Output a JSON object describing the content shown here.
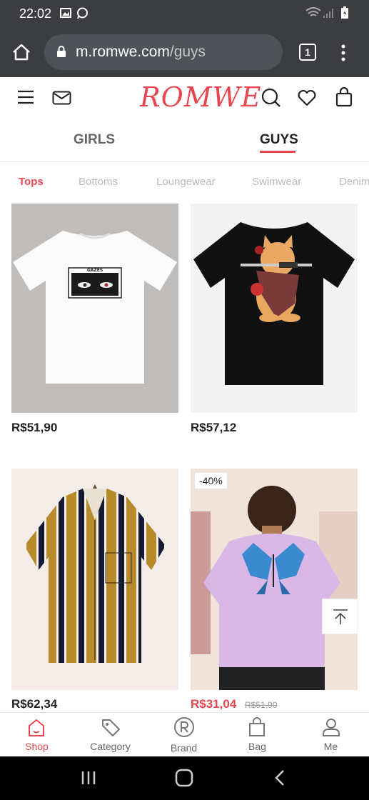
{
  "status_bar": {
    "time": "22:02"
  },
  "browser": {
    "domain": "m.romwe.com",
    "path": "/guys",
    "tab_count": "1"
  },
  "site": {
    "logo": "ROMWE",
    "gender_tabs": [
      {
        "label": "GIRLS"
      },
      {
        "label": "GUYS"
      }
    ],
    "categories": [
      "Tops",
      "Bottoms",
      "Loungewear",
      "Swimwear",
      "Denim"
    ]
  },
  "products": [
    {
      "price": "R$51,90",
      "image_text": "GAZES"
    },
    {
      "price": "R$57,12"
    },
    {
      "price": "R$62,34"
    },
    {
      "price": "R$31,04",
      "old_price": "R$51,90",
      "badge": "-40%"
    }
  ],
  "bottom_nav": [
    {
      "label": "Shop"
    },
    {
      "label": "Category"
    },
    {
      "label": "Brand"
    },
    {
      "label": "Bag"
    },
    {
      "label": "Me"
    }
  ],
  "colors": {
    "accent": "#e8474f",
    "chrome": "#3b3d40"
  }
}
